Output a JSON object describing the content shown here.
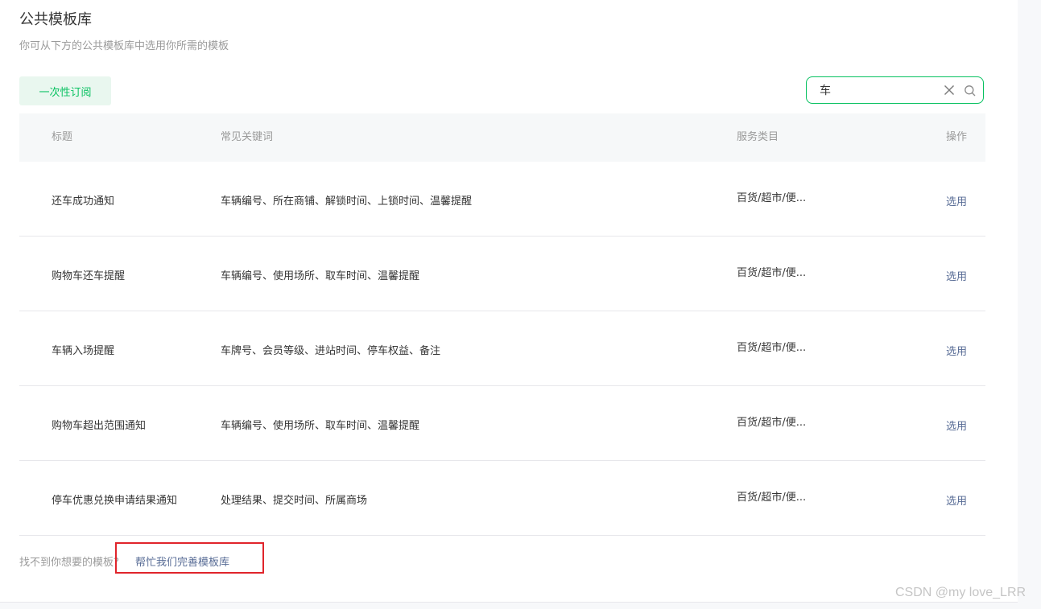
{
  "header": {
    "title": "公共模板库",
    "subtitle": "你可从下方的公共模板库中选用你所需的模板"
  },
  "toolbar": {
    "subscribe_label": "一次性订阅",
    "search_value": "车",
    "clear_icon": "close-icon",
    "search_icon": "search-icon"
  },
  "table": {
    "headers": {
      "title": "标题",
      "keywords": "常见关键词",
      "category": "服务类目",
      "action": "操作"
    },
    "rows": [
      {
        "title": "还车成功通知",
        "keywords": "车辆编号、所在商铺、解锁时间、上锁时间、温馨提醒",
        "category": "百货/超市/便...",
        "action": "选用"
      },
      {
        "title": "购物车还车提醒",
        "keywords": "车辆编号、使用场所、取车时间、温馨提醒",
        "category": "百货/超市/便...",
        "action": "选用"
      },
      {
        "title": "车辆入场提醒",
        "keywords": "车牌号、会员等级、进站时间、停车权益、备注",
        "category": "百货/超市/便...",
        "action": "选用"
      },
      {
        "title": "购物车超出范围通知",
        "keywords": "车辆编号、使用场所、取车时间、温馨提醒",
        "category": "百货/超市/便...",
        "action": "选用"
      },
      {
        "title": "停车优惠兑换申请结果通知",
        "keywords": "处理结果、提交时间、所属商场",
        "category": "百货/超市/便...",
        "action": "选用"
      }
    ]
  },
  "footer": {
    "question": "找不到你想要的模板？",
    "help_link": "帮忙我们完善模板库"
  },
  "watermark": "CSDN @my love_LRR",
  "colors": {
    "accent_green": "#07c160",
    "link_blue": "#576b95",
    "highlight_red": "#e0242b"
  }
}
